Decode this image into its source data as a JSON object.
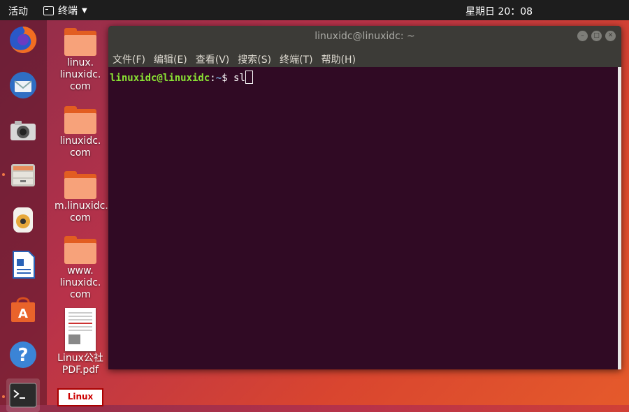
{
  "topbar": {
    "activities": "活动",
    "app_name": "终端",
    "clock": "星期日 20：08"
  },
  "dock": {
    "items": [
      {
        "icon": "firefox-icon"
      },
      {
        "icon": "thunderbird-icon"
      },
      {
        "icon": "camera-icon"
      },
      {
        "icon": "files-icon"
      },
      {
        "icon": "rhythmbox-icon"
      },
      {
        "icon": "writer-icon"
      },
      {
        "icon": "software-center-icon"
      },
      {
        "icon": "help-icon"
      },
      {
        "icon": "terminal-icon"
      }
    ]
  },
  "desktop": {
    "icons": [
      {
        "label": "linux.\nlinuxidc.\ncom",
        "type": "folder"
      },
      {
        "label": "linuxidc.\ncom",
        "type": "folder"
      },
      {
        "label": "m.linuxidc.\ncom",
        "type": "folder"
      },
      {
        "label": "www.\nlinuxidc.\ncom",
        "type": "folder"
      },
      {
        "label": "Linux公社\nPDF.pdf",
        "type": "pdf"
      },
      {
        "label": "Linux",
        "type": "image"
      }
    ]
  },
  "terminal": {
    "title": "linuxidc@linuxidc: ~",
    "menu": [
      "文件(F)",
      "编辑(E)",
      "查看(V)",
      "搜索(S)",
      "终端(T)",
      "帮助(H)"
    ],
    "prompt_user": "linuxidc@linuxidc",
    "prompt_sep": ":",
    "prompt_path": "~",
    "prompt_symbol": "$ ",
    "command": "sl"
  },
  "colors": {
    "terminal_bg": "#300a24",
    "prompt_user": "#8ae234",
    "prompt_path": "#729fcf"
  }
}
